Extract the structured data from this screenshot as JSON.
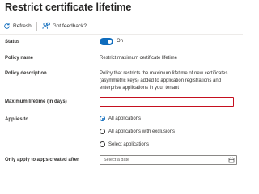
{
  "page": {
    "title": "Restrict certificate lifetime"
  },
  "toolbar": {
    "refresh_label": "Refresh",
    "feedback_label": "Got feedback?",
    "refresh_icon": "refresh-icon",
    "feedback_icon": "feedback-person-icon"
  },
  "form": {
    "status": {
      "label": "Status",
      "toggle_on": true,
      "toggle_text": "On"
    },
    "policy_name": {
      "label": "Policy name",
      "value": "Restrict maximum certificate lifetime"
    },
    "policy_description": {
      "label": "Policy description",
      "value": "Policy that restricts the maximum lifetime of new certificates (asymmetric keys) added to application registrations and enterprise applications in your tenant"
    },
    "maximum_lifetime": {
      "label": "Maximum lifetime (in days)",
      "value": ""
    },
    "applies_to": {
      "label": "Applies to",
      "selected_index": 0,
      "options": [
        "All applications",
        "All applications with exclusions",
        "Select applications"
      ]
    },
    "only_apply": {
      "label": "Only apply to apps created after",
      "placeholder": "Select a date"
    }
  },
  "colors": {
    "accent": "#0f6cbd",
    "error_border": "#c50f1f"
  }
}
